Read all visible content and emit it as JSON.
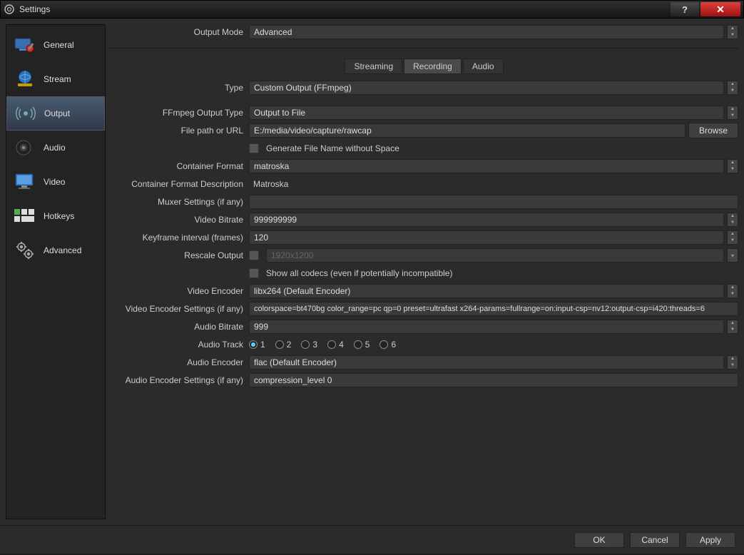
{
  "window": {
    "title": "Settings",
    "help": "?",
    "close": "✕"
  },
  "sidebar": {
    "items": [
      {
        "label": "General"
      },
      {
        "label": "Stream"
      },
      {
        "label": "Output"
      },
      {
        "label": "Audio"
      },
      {
        "label": "Video"
      },
      {
        "label": "Hotkeys"
      },
      {
        "label": "Advanced"
      }
    ],
    "active_index": 2
  },
  "output_mode": {
    "label": "Output Mode",
    "value": "Advanced"
  },
  "tabs": {
    "items": [
      "Streaming",
      "Recording",
      "Audio"
    ],
    "active_index": 1
  },
  "fields": {
    "type": {
      "label": "Type",
      "value": "Custom Output (FFmpeg)"
    },
    "ffmpeg_output_type": {
      "label": "FFmpeg Output Type",
      "value": "Output to File"
    },
    "file_path": {
      "label": "File path or URL",
      "value": "E:/media/video/capture/rawcap",
      "browse": "Browse"
    },
    "gen_no_space": {
      "label": "Generate File Name without Space",
      "checked": false
    },
    "container_format": {
      "label": "Container Format",
      "value": "matroska"
    },
    "container_desc": {
      "label": "Container Format Description",
      "value": "Matroska"
    },
    "muxer_settings": {
      "label": "Muxer Settings (if any)",
      "value": ""
    },
    "video_bitrate": {
      "label": "Video Bitrate",
      "value": "999999999"
    },
    "keyframe_interval": {
      "label": "Keyframe interval (frames)",
      "value": "120"
    },
    "rescale_output": {
      "label": "Rescale Output",
      "placeholder": "1920x1200",
      "checked": false
    },
    "show_all_codecs": {
      "label": "Show all codecs (even if potentially incompatible)",
      "checked": false
    },
    "video_encoder": {
      "label": "Video Encoder",
      "value": "libx264 (Default Encoder)"
    },
    "video_enc_settings": {
      "label": "Video Encoder Settings (if any)",
      "value": "colorspace=bt470bg color_range=pc qp=0 preset=ultrafast x264-params=fullrange=on:input-csp=nv12:output-csp=i420:threads=6"
    },
    "audio_bitrate": {
      "label": "Audio Bitrate",
      "value": "999"
    },
    "audio_track": {
      "label": "Audio Track",
      "options": [
        "1",
        "2",
        "3",
        "4",
        "5",
        "6"
      ],
      "selected": "1"
    },
    "audio_encoder": {
      "label": "Audio Encoder",
      "value": "flac (Default Encoder)"
    },
    "audio_enc_settings": {
      "label": "Audio Encoder Settings (if any)",
      "value": "compression_level 0"
    }
  },
  "footer": {
    "ok": "OK",
    "cancel": "Cancel",
    "apply": "Apply"
  }
}
